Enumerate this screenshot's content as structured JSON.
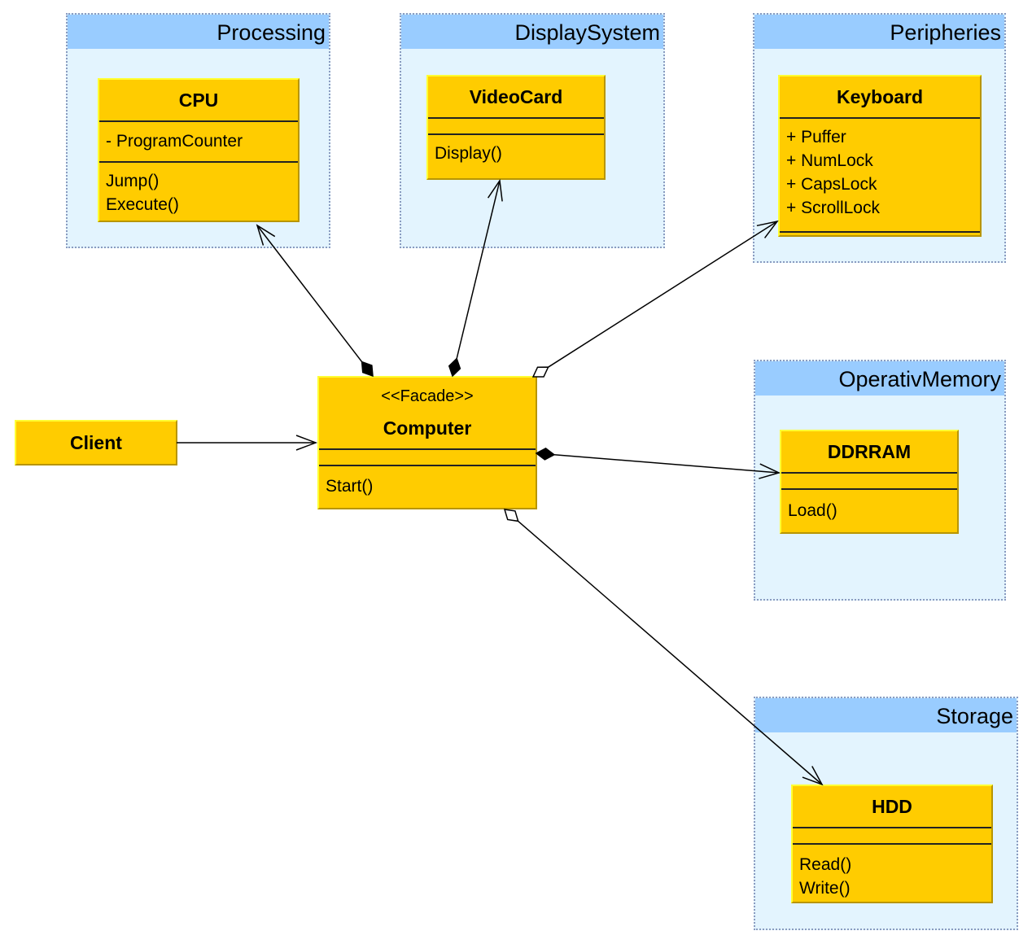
{
  "packages": [
    {
      "name": "Processing"
    },
    {
      "name": "DisplaySystem"
    },
    {
      "name": "Peripheries"
    },
    {
      "name": "OperativMemory"
    },
    {
      "name": "Storage"
    }
  ],
  "classes": {
    "cpu": {
      "name": "CPU",
      "attributes": [
        "- ProgramCounter"
      ],
      "operations": [
        "Jump()",
        "Execute()"
      ]
    },
    "videocard": {
      "name": "VideoCard",
      "operations": [
        "Display()"
      ]
    },
    "keyboard": {
      "name": "Keyboard",
      "attributes": [
        "+ Puffer",
        "+ NumLock",
        "+ CapsLock",
        "+ ScrollLock"
      ]
    },
    "client": {
      "name": "Client"
    },
    "computer": {
      "stereotype": "<<Facade>>",
      "name": "Computer",
      "operations": [
        "Start()"
      ]
    },
    "ddrram": {
      "name": "DDRRAM",
      "operations": [
        "Load()"
      ]
    },
    "hdd": {
      "name": "HDD",
      "operations": [
        "Read()",
        "Write()"
      ]
    }
  },
  "relations": [
    {
      "from": "Computer",
      "to": "CPU",
      "type": "composition"
    },
    {
      "from": "Computer",
      "to": "VideoCard",
      "type": "composition"
    },
    {
      "from": "Computer",
      "to": "Keyboard",
      "type": "aggregation"
    },
    {
      "from": "Client",
      "to": "Computer",
      "type": "association"
    },
    {
      "from": "Computer",
      "to": "DDRRAM",
      "type": "composition"
    },
    {
      "from": "Computer",
      "to": "HDD",
      "type": "aggregation"
    }
  ],
  "colors": {
    "class_fill": "#ffcc00",
    "package_fill": "#e3f4fe",
    "package_header": "#99ccff"
  }
}
